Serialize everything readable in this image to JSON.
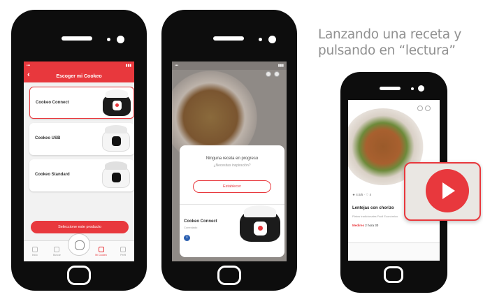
{
  "caption": {
    "line1": "Lanzando una receta y",
    "line2": "pulsando en “lectura”"
  },
  "phone1": {
    "header_title": "Escoger mi Cookeo",
    "products": [
      "Cookeo Connect",
      "Cookeo USB",
      "Cookeo Standard"
    ],
    "select_button": "Seleccione este producto",
    "tabs": [
      "Inicio",
      "Buscar",
      "",
      "Mi Cookeo",
      "Perfil"
    ]
  },
  "phone2": {
    "dialog_title": "Ninguna receta en progreso",
    "dialog_subtitle": "¿Necesitas inspiración?",
    "dialog_button": "Establecer",
    "device_name": "Cookeo Connect",
    "device_status": "Conectado",
    "info_icon": "i"
  },
  "phone3": {
    "rating": "★ 4.5/5 · ♡ 4",
    "recipe_title": "Lentejas con chorizo",
    "recipe_tags": "Platos tradicionales Fácil Económico",
    "duration_label": "Medires",
    "duration_value": "2 hora 30"
  },
  "colors": {
    "accent": "#e8383d"
  }
}
